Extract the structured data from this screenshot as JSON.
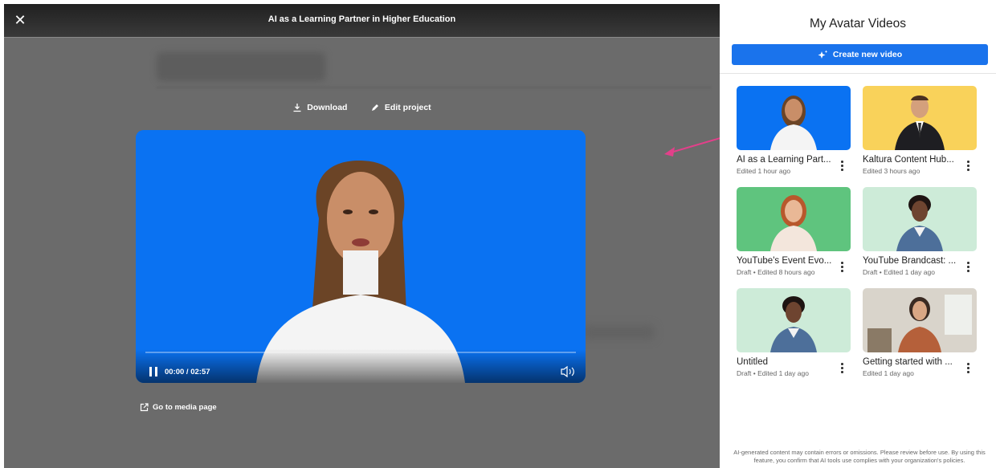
{
  "player": {
    "title": "AI as a Learning Partner in Higher Education",
    "close_icon": "✕",
    "download_label": "Download",
    "edit_label": "Edit project",
    "time": "00:00 / 02:57",
    "progress": 0,
    "goto_label": "Go to media page"
  },
  "panel": {
    "title": "My Avatar Videos",
    "create_label": "Create new video",
    "disclaimer": "AI-generated content may contain errors or omissions. Please review before use. By using this feature, you confirm that AI tools use complies with your organization's policies."
  },
  "videos": [
    {
      "title": "AI as a Learning Part...",
      "meta": "Edited 1 hour ago",
      "bg": "#0a72f2"
    },
    {
      "title": "Kaltura Content Hub...",
      "meta": "Edited 3 hours ago",
      "bg": "#f9d25a"
    },
    {
      "title": "YouTube's Event Evo...",
      "meta": "Draft  •  Edited 8 hours ago",
      "bg": "#5fc47e"
    },
    {
      "title": "YouTube Brandcast: ...",
      "meta": "Draft  •  Edited 1 day ago",
      "bg": "#cdebd8"
    },
    {
      "title": "Untitled",
      "meta": "Draft  •  Edited 1 day ago",
      "bg": "#cdebd8"
    },
    {
      "title": "Getting started with ...",
      "meta": "Edited 1 day ago",
      "bg": "#d9d4cb"
    }
  ]
}
